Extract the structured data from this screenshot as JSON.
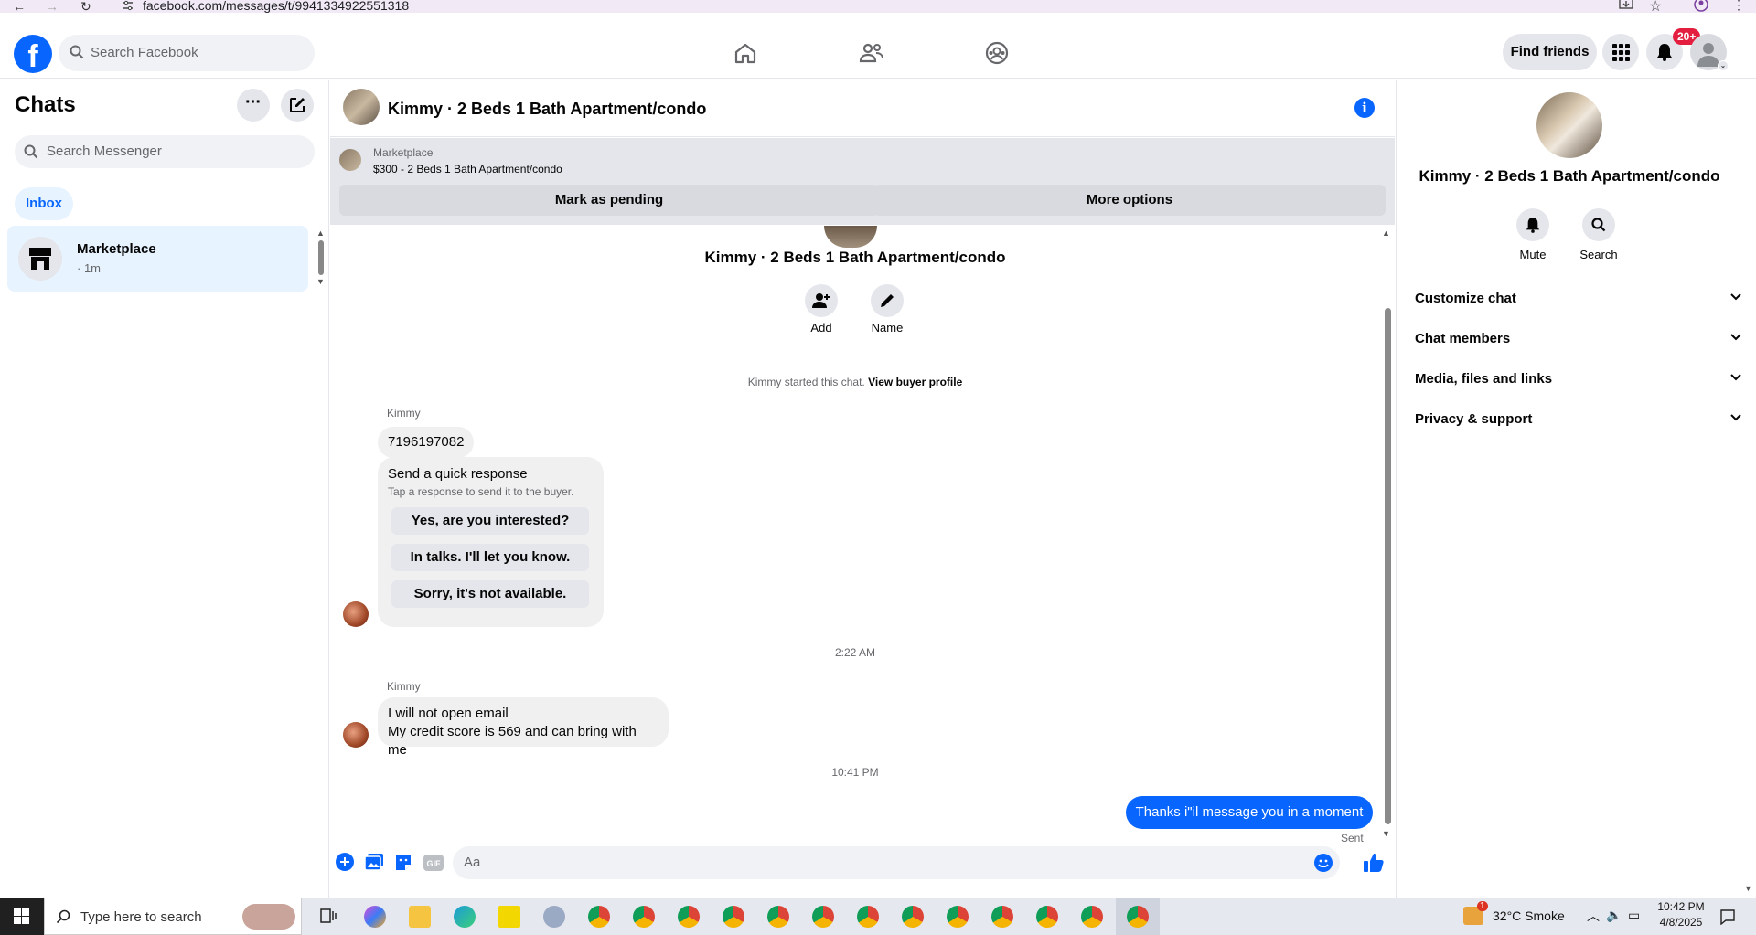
{
  "browser": {
    "url": "facebook.com/messages/t/9941334922551318",
    "back": "←",
    "forward": "→",
    "reload": "↻"
  },
  "header": {
    "logo_text": "f",
    "search_placeholder": "Search Facebook",
    "nav_icons": [
      "home-icon",
      "friends-icon",
      "groups-icon"
    ],
    "find_friends_label": "Find friends",
    "notification_badge": "20+"
  },
  "left": {
    "title": "Chats",
    "search_placeholder": "Search Messenger",
    "inbox_label": "Inbox",
    "chats": [
      {
        "name": "Marketplace",
        "time": "· 1m"
      }
    ]
  },
  "conversation": {
    "title": "Kimmy · 2 Beds 1 Bath Apartment/condo",
    "banner": {
      "source": "Marketplace",
      "listing": "$300 - 2 Beds 1 Bath Apartment/condo",
      "mark_pending_label": "Mark as pending",
      "more_options_label": "More options"
    },
    "intro_name": "Kimmy · 2 Beds 1 Bath Apartment/condo",
    "add_label": "Add",
    "name_label": "Name",
    "started_text": "Kimmy started this chat.",
    "view_profile_link": "View buyer profile",
    "sender1": "Kimmy",
    "msg_phone": "7196197082",
    "quick_title": "Send a quick response",
    "quick_sub": "Tap a response to send it to the buyer.",
    "quick_responses": [
      "Yes, are you interested?",
      "In talks. I'll let you know.",
      "Sorry, it's not available."
    ],
    "time1": "2:22 AM",
    "sender2": "Kimmy",
    "msg2_line1": "I will not open email",
    "msg2_line2": "My credit score is 569 and can bring with me",
    "time2": "10:41 PM",
    "sent_msg": "Thanks i\"il message you in a moment",
    "sent_status": "Sent",
    "composer_placeholder": "Aa"
  },
  "right": {
    "name": "Kimmy · 2 Beds 1 Bath Apartment/condo",
    "mute_label": "Mute",
    "search_label": "Search",
    "sections": [
      "Customize chat",
      "Chat members",
      "Media, files and links",
      "Privacy & support"
    ]
  },
  "taskbar": {
    "search_placeholder": "Type here to search",
    "weather": "32°C  Smoke",
    "weather_badge": "1",
    "time": "10:42 PM",
    "date": "4/8/2025"
  },
  "colors": {
    "accent": "#0866ff",
    "bubble": "#f0f0f0",
    "badge": "#e41e3f"
  }
}
